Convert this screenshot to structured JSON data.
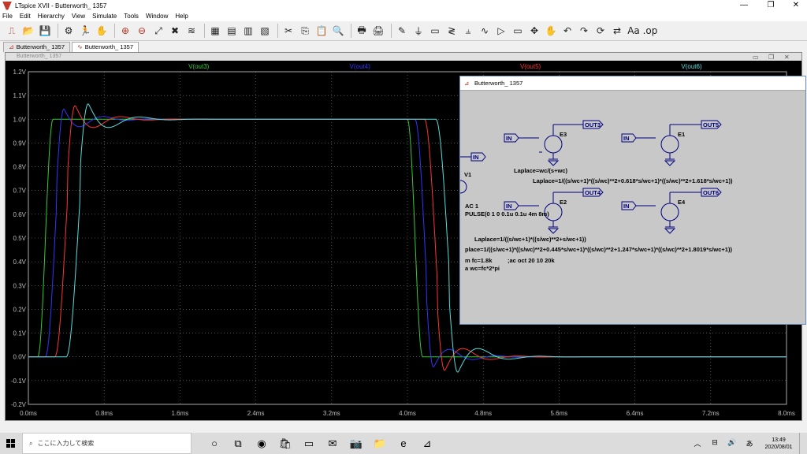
{
  "window": {
    "title": "LTspice XVII - Butterworth_ 1357",
    "ctl_min": "—",
    "ctl_max": "❐",
    "ctl_close": "✕"
  },
  "menu": [
    "File",
    "Edit",
    "Hierarchy",
    "View",
    "Simulate",
    "Tools",
    "Window",
    "Help"
  ],
  "toolbar": {
    "icons": [
      "schematic-icon",
      "open-icon",
      "save-icon",
      "control-panel-icon",
      "run-icon",
      "pan-icon",
      "zoom-in-icon",
      "zoom-out-icon",
      "zoom-full-icon",
      "zoom-cancel-icon",
      "autorange-icon",
      "grid-icon",
      "tile-horizontal-icon",
      "cascade-icon",
      "tile-vertical-icon",
      "cut-icon",
      "copy-icon",
      "paste-icon",
      "find-icon",
      "print-setup-icon",
      "print-icon",
      "draw-wire-icon",
      "ground-icon",
      "label-net-icon",
      "resistor-icon",
      "capacitor-icon",
      "inductor-icon",
      "diode-icon",
      "component-icon",
      "move-icon",
      "drag-icon",
      "undo-icon",
      "redo-icon",
      "rotate-icon",
      "mirror-icon",
      "text-icon",
      "spice-directive-icon"
    ],
    "glyphs": [
      "⎍",
      "📂",
      "💾",
      "⚙",
      "🏃",
      "✋",
      "⊕",
      "⊖",
      "⤢",
      "✖",
      "≋",
      "▦",
      "▤",
      "▥",
      "▧",
      "✂",
      "⎘",
      "📋",
      "🔍",
      "🖶",
      "🖨",
      "✎",
      "⏚",
      "▭",
      "≷",
      "⫨",
      "∿",
      "▷",
      "▭",
      "✥",
      "✋",
      "↶",
      "↷",
      "⟳",
      "⇄",
      "Aa",
      ".op"
    ]
  },
  "tabs": [
    {
      "label": "Butterworth_ 1357",
      "icon": "schematic-tab-icon"
    },
    {
      "label": "Butterworth_ 1357",
      "icon": "waveform-tab-icon"
    }
  ],
  "plot": {
    "header_text": "Butterworth_ 1357",
    "ctl_min": "▭",
    "ctl_max": "❐",
    "ctl_close": "✕",
    "bg": "#000000",
    "grid_color": "#808080"
  },
  "chart_data": {
    "type": "line",
    "xlim": [
      0,
      8.0
    ],
    "ylim": [
      -0.2,
      1.2
    ],
    "xlabel": "",
    "ylabel": "",
    "x_ticks": [
      "0.0ms",
      "0.8ms",
      "1.6ms",
      "2.4ms",
      "3.2ms",
      "4.0ms",
      "4.8ms",
      "5.6ms",
      "6.4ms",
      "7.2ms",
      "8.0ms"
    ],
    "y_ticks": [
      "1.2V",
      "1.1V",
      "1.0V",
      "0.9V",
      "0.8V",
      "0.7V",
      "0.6V",
      "0.5V",
      "0.4V",
      "0.3V",
      "0.2V",
      "0.1V",
      "0.0V",
      "-0.1V",
      "-0.2V"
    ],
    "series": [
      {
        "name": "V(out3)",
        "color": "#33cc33",
        "delay": 0.0,
        "rise": 0.16,
        "overshoot": 0.0,
        "ring": 0.0
      },
      {
        "name": "V(out4)",
        "color": "#3333ff",
        "delay": 0.08,
        "rise": 0.2,
        "overshoot": 0.085,
        "ring": 1.1
      },
      {
        "name": "V(out5)",
        "color": "#ff3333",
        "delay": 0.18,
        "rise": 0.22,
        "overshoot": 0.11,
        "ring": 0.95
      },
      {
        "name": "V(out6)",
        "color": "#55dddd",
        "delay": 0.3,
        "rise": 0.24,
        "overshoot": 0.125,
        "ring": 0.85
      }
    ],
    "pulse_start_ms": 0.1,
    "pulse_fall_ms": 4.0
  },
  "schematic": {
    "title": "Butterworth_ 1357",
    "nets": {
      "in": "IN",
      "out3": "OUT3",
      "out4": "OUT4",
      "out5": "OUT5",
      "out6": "OUT6"
    },
    "parts": {
      "e3": "E3",
      "e1": "E1",
      "e2": "E2",
      "e4": "E4",
      "v1": "V1"
    },
    "texts": {
      "laplace_e3": "Laplace=wc/(s+wc)",
      "laplace_e1": "Laplace=1/((s/wc+1)*((s/wc)**2+0.618*s/wc+1)*((s/wc)**2+1.618*s/wc+1))",
      "ac": "AC 1",
      "pulse": "PULSE(0 1 0 0.1u 0.1u 4m 8m)",
      "laplace_e2": "Laplace=1/((s/wc+1)*((s/wc)**2+s/wc+1))",
      "laplace_e4": "place=1/((s/wc+1)*((s/wc)**2+0.445*s/wc+1)*((s/wc)**2+1.247*s/wc+1)*((s/wc)**2+1.8019*s/wc+1))",
      "param_fc": "m fc=1.8k",
      "ac_cmd": ";ac oct 20 10 20k",
      "param_wc": "a wc=fc*2*pi"
    }
  },
  "taskbar": {
    "search_placeholder": "ここに入力して検索",
    "apps": [
      "task-view-icon",
      "cortana-icon",
      "edge-icon",
      "store-icon",
      "files-icon",
      "mail-icon",
      "camera-icon",
      "explorer-icon",
      "ie-icon",
      "ltspice-taskbar-icon"
    ],
    "app_glyphs": [
      "○",
      "⧉",
      "◉",
      "🛍",
      "▭",
      "✉",
      "📷",
      "📁",
      "e",
      "⊿"
    ],
    "tray_glyphs": [
      "︿",
      "⊟",
      "🔊",
      "あ"
    ],
    "time": "13:49",
    "date": "2020/08/01"
  }
}
